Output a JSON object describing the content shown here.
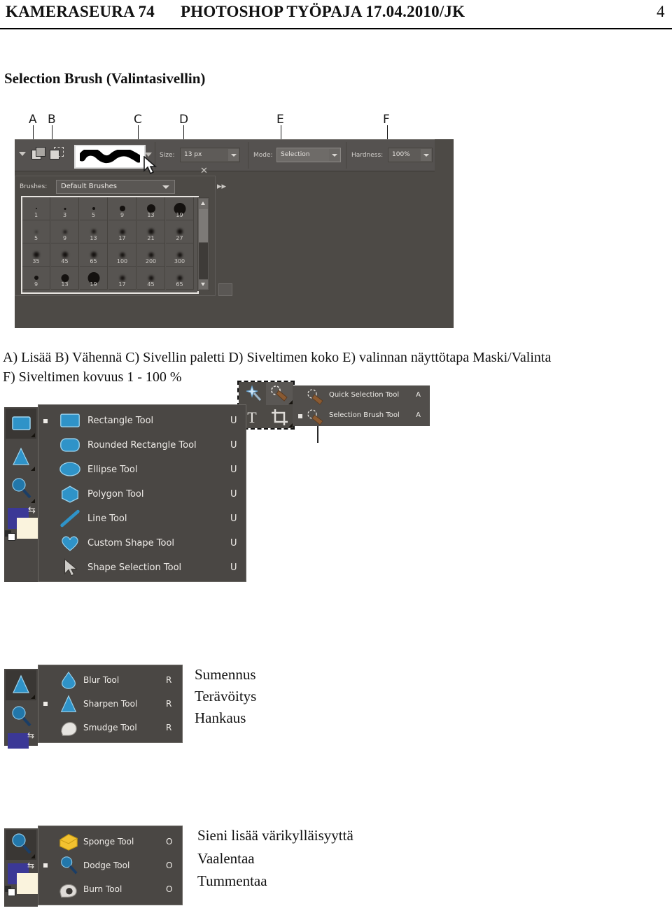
{
  "header": {
    "left": "KAMERASEURA 74",
    "middle": "PHOTOSHOP TYÖPAJA 17.04.2010/JK",
    "page_number": "4"
  },
  "section_title": "Selection Brush (Valintasivellin)",
  "figure_selection_brush": {
    "callout_letters": [
      "A",
      "B",
      "C",
      "D",
      "E",
      "F"
    ],
    "options_bar": {
      "size_label": "Size:",
      "size_value": "13 px",
      "mode_label": "Mode:",
      "mode_value": "Selection",
      "hardness_label": "Hardness:",
      "hardness_value": "100%"
    },
    "brushes_panel": {
      "label": "Brushes:",
      "preset": "Default Brushes",
      "close_glyph": "✕",
      "collapse_glyph": "▸▸",
      "grid": [
        [
          {
            "n": "1",
            "d": 2
          },
          {
            "n": "3",
            "d": 3
          },
          {
            "n": "5",
            "d": 4
          },
          {
            "n": "9",
            "d": 8
          },
          {
            "n": "13",
            "d": 12
          },
          {
            "n": "19",
            "d": 17
          }
        ],
        [
          {
            "n": "5",
            "d": 3
          },
          {
            "n": "9",
            "d": 5
          },
          {
            "n": "13",
            "d": 6
          },
          {
            "n": "17",
            "d": 7
          },
          {
            "n": "21",
            "d": 8
          },
          {
            "n": "27",
            "d": 8
          }
        ],
        [
          {
            "n": "35",
            "d": 8
          },
          {
            "n": "45",
            "d": 8
          },
          {
            "n": "65",
            "d": 8
          },
          {
            "n": "100",
            "d": 7
          },
          {
            "n": "200",
            "d": 7
          },
          {
            "n": "300",
            "d": 7
          }
        ],
        [
          {
            "n": "9",
            "d": 6
          },
          {
            "n": "13",
            "d": 11
          },
          {
            "n": "19",
            "d": 17
          },
          {
            "n": "17",
            "d": 7
          },
          {
            "n": "45",
            "d": 7
          },
          {
            "n": "65",
            "d": 7
          }
        ]
      ]
    },
    "flyout": {
      "items": [
        {
          "label": "Quick Selection Tool",
          "shortcut": "A",
          "selected": false
        },
        {
          "label": "Selection Brush Tool",
          "shortcut": "A",
          "selected": true
        }
      ]
    }
  },
  "caption": {
    "line1": "A) Lisää   B) Vähennä  C) Sivellin paletti D) Siveltimen koko E) valinnan näyttötapa Maski/Valinta",
    "line2": "F) Siveltimen kovuus 1 - 100 %"
  },
  "figure_shape_tools": {
    "items": [
      {
        "label": "Rectangle Tool",
        "shortcut": "U",
        "icon": "rectangle-icon",
        "selected": true
      },
      {
        "label": "Rounded Rectangle Tool",
        "shortcut": "U",
        "icon": "rounded-rectangle-icon",
        "selected": false
      },
      {
        "label": "Ellipse Tool",
        "shortcut": "U",
        "icon": "ellipse-icon",
        "selected": false
      },
      {
        "label": "Polygon Tool",
        "shortcut": "U",
        "icon": "polygon-icon",
        "selected": false
      },
      {
        "label": "Line Tool",
        "shortcut": "U",
        "icon": "line-icon",
        "selected": false
      },
      {
        "label": "Custom Shape Tool",
        "shortcut": "U",
        "icon": "heart-icon",
        "selected": false
      },
      {
        "label": "Shape Selection Tool",
        "shortcut": "U",
        "icon": "arrow-pointer-icon",
        "selected": false
      }
    ]
  },
  "figure_blur_tools": {
    "items": [
      {
        "label": "Blur Tool",
        "shortcut": "R",
        "icon": "waterdrop-icon",
        "selected": false
      },
      {
        "label": "Sharpen Tool",
        "shortcut": "R",
        "icon": "triangle-icon",
        "selected": true
      },
      {
        "label": "Smudge Tool",
        "shortcut": "R",
        "icon": "finger-icon",
        "selected": false
      }
    ],
    "translations": [
      "Sumennus",
      "Terävöitys",
      "Hankaus"
    ]
  },
  "figure_sponge_tools": {
    "items": [
      {
        "label": "Sponge Tool",
        "shortcut": "O",
        "icon": "sponge-icon",
        "selected": false
      },
      {
        "label": "Dodge Tool",
        "shortcut": "O",
        "icon": "dodge-icon",
        "selected": true
      },
      {
        "label": "Burn Tool",
        "shortcut": "O",
        "icon": "burn-hand-icon",
        "selected": false
      }
    ],
    "translations": [
      "Sieni lisää värikylläisyyttä",
      "Vaalentaa",
      "Tummentaa"
    ]
  },
  "colors": {
    "panel_bg": "#4d4a46",
    "menu_bg": "#4a4744",
    "shape_blue": "#2f93c8",
    "foreground": "#3b3896",
    "background": "#faf3dd"
  }
}
